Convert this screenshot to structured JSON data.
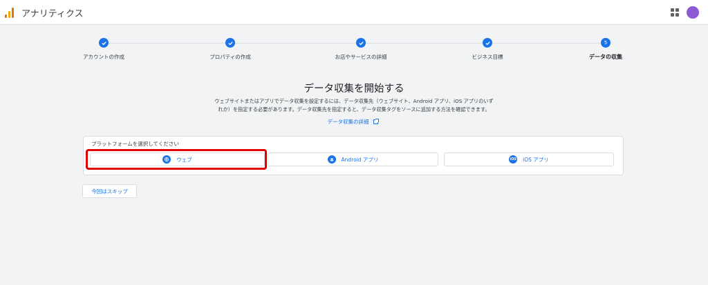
{
  "header": {
    "app_title": "アナリティクス",
    "logo_icon": "google-analytics-logo",
    "apps_icon": "apps-grid-icon",
    "avatar_color": "#8d5ad6"
  },
  "stepper": {
    "steps": [
      {
        "label": "アカウントの作成",
        "status": "done"
      },
      {
        "label": "プロパティの作成",
        "status": "done"
      },
      {
        "label": "お店やサービスの詳細",
        "status": "done"
      },
      {
        "label": "ビジネス目標",
        "status": "done"
      },
      {
        "label": "データの収集",
        "status": "current",
        "number": "5"
      }
    ]
  },
  "main": {
    "heading": "データ収集を開始する",
    "description_line1": "ウェブサイトまたはアプリでデータ収集を設定するには、データ収集先（ウェブサイト、Android アプリ、iOS アプリのいず",
    "description_line2": "れか）を指定する必要があります。データ収集先を指定すると、データ収集タグをソースに追加する方法を確認できます。",
    "details_link": "データ収集の詳細"
  },
  "platform": {
    "label": "プラットフォームを選択してください",
    "options": [
      {
        "label": "ウェブ",
        "icon": "globe-icon",
        "highlighted": true
      },
      {
        "label": "Android アプリ",
        "icon": "android-icon"
      },
      {
        "label": "iOS アプリ",
        "icon": "ios-icon",
        "icon_text": "iOS"
      }
    ]
  },
  "skip_button": "今回はスキップ",
  "colors": {
    "accent": "#1a73e8",
    "highlight": "#e00000"
  }
}
